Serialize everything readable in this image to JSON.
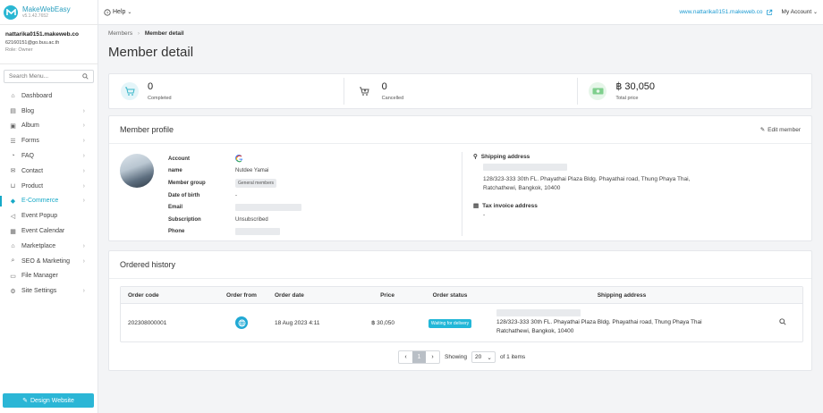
{
  "brand": {
    "name": "MakeWebEasy",
    "version": "v5.1.42.7652"
  },
  "user": {
    "site": "nattarika0151.makeweb.co",
    "email": "62160151@go.buu.ac.th",
    "role": "Role: Owner"
  },
  "search": {
    "placeholder": "Search Menu..."
  },
  "menu": [
    {
      "label": "Dashboard",
      "icon": "home-icon",
      "chev": false
    },
    {
      "label": "Blog",
      "icon": "document-icon",
      "chev": true
    },
    {
      "label": "Album",
      "icon": "image-icon",
      "chev": true
    },
    {
      "label": "Forms",
      "icon": "list-icon",
      "chev": true
    },
    {
      "label": "FAQ",
      "icon": "chat-icon",
      "chev": true
    },
    {
      "label": "Contact",
      "icon": "mail-icon",
      "chev": true
    },
    {
      "label": "Product",
      "icon": "cart-icon",
      "chev": true
    },
    {
      "label": "E-Commerce",
      "icon": "tag-icon",
      "chev": true,
      "active": true
    },
    {
      "label": "Event Popup",
      "icon": "megaphone-icon",
      "chev": false
    },
    {
      "label": "Event Calendar",
      "icon": "calendar-icon",
      "chev": false
    },
    {
      "label": "Marketplace",
      "icon": "store-icon",
      "chev": true
    },
    {
      "label": "SEO & Marketing",
      "icon": "search-icon",
      "chev": true
    },
    {
      "label": "File Manager",
      "icon": "folder-icon",
      "chev": false
    },
    {
      "label": "Site Settings",
      "icon": "gear-icon",
      "chev": true
    }
  ],
  "design_button": "Design Website",
  "topbar": {
    "help": "Help",
    "site_link": "www.nattarika0151.makeweb.co",
    "account": "My Account"
  },
  "breadcrumb": {
    "parent": "Members",
    "separator": "›",
    "current": "Member detail"
  },
  "page_title": "Member detail",
  "stats": [
    {
      "value": "0",
      "label": "Completed"
    },
    {
      "value": "0",
      "label": "Cancelled"
    },
    {
      "value": "฿ 30,050",
      "label": "Total price"
    }
  ],
  "profile": {
    "heading": "Member profile",
    "edit_label": "Edit member",
    "labels": {
      "account": "Account",
      "name": "name",
      "group": "Member group",
      "dob": "Date of birth",
      "email": "Email",
      "subscription": "Subscription",
      "phone": "Phone"
    },
    "values": {
      "account_icon": "google-icon",
      "name": "Nutdee Yamai",
      "group": "General members",
      "dob": "-",
      "subscription": "Unsubscribed"
    },
    "shipping_heading": "Shipping address",
    "shipping_address": "128/323-333 30th FL. Phayathai Plaza Bldg. Phayathai road, Thung Phaya Thai, Ratchathewi, Bangkok, 10400",
    "tax_heading": "Tax invoice address",
    "tax_value": "-"
  },
  "orders": {
    "heading": "Ordered history",
    "columns": [
      "Order code",
      "Order from",
      "Order date",
      "Price",
      "Order status",
      "Shipping address"
    ],
    "rows": [
      {
        "code": "202308000001",
        "from_icon": "globe-icon",
        "date": "18 Aug 2023 4:11",
        "price": "฿ 30,050",
        "status": "Waiting for delivery",
        "address": "128/323-333 30th FL. Phayathai Plaza Bldg. Phayathai road, Thung Phaya Thai Ratchathewi, Bangkok, 10400"
      }
    ],
    "pager": {
      "current": "1",
      "showing": "Showing",
      "per_page": "20",
      "of_items": "of 1 items"
    }
  },
  "colors": {
    "accent": "#16a9c7",
    "button": "#2bb6d6",
    "badge": "#22b7d8",
    "link": "#1d9bd2"
  }
}
